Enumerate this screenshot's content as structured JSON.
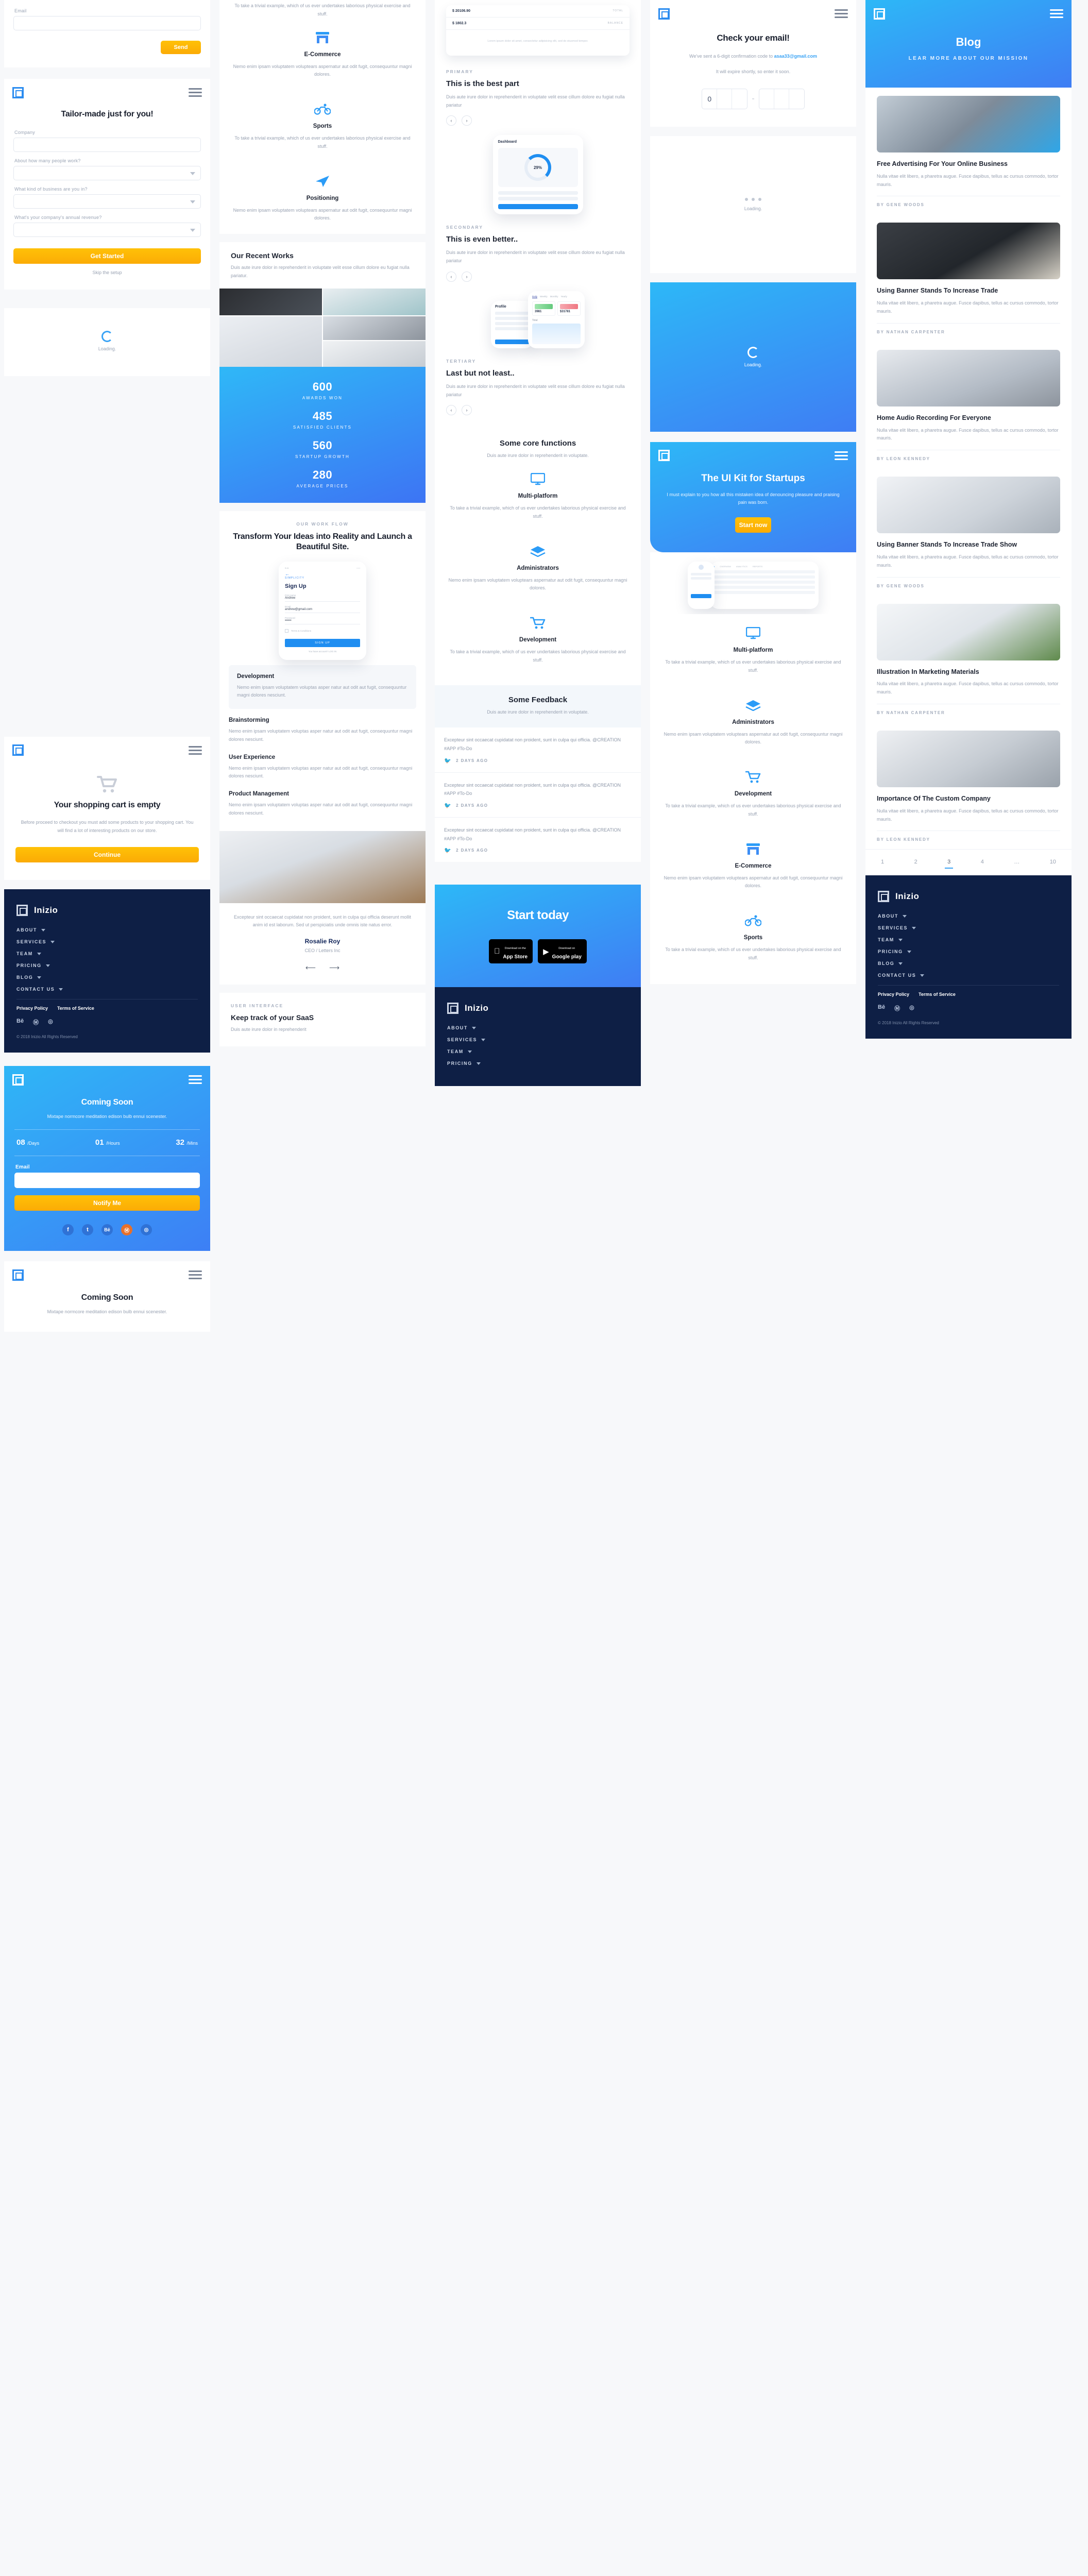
{
  "brand": {
    "name": "Inizio",
    "logo_icon": "inizio-logo-icon"
  },
  "colors": {
    "accent_blue": "#3aa3f5",
    "accent_yellow": "#fbab06",
    "footer_navy": "#0e1f45"
  },
  "footer": {
    "nav": [
      "ABOUT",
      "SERVICES",
      "TEAM",
      "PRICING",
      "BLOG",
      "CONTACT US"
    ],
    "legal": [
      "Privacy Policy",
      "Terms of Service"
    ],
    "social": [
      "Bē",
      "Ⓜ",
      "◎"
    ],
    "copyright": "© 2018 Inizio All Rights Reserved"
  },
  "col1": {
    "contact_form": {
      "email_label": "Email",
      "email_value": "",
      "send_label": "Send"
    },
    "tailor": {
      "title": "Tailor-made just for you!",
      "fields": [
        {
          "label": "Company",
          "type": "text",
          "value": ""
        },
        {
          "label": "About how many people work?",
          "type": "select",
          "value": ""
        },
        {
          "label": "What kind of business are you in?",
          "type": "select",
          "value": ""
        },
        {
          "label": "What's your company's annual revenue?",
          "type": "select",
          "value": ""
        }
      ],
      "submit_label": "Get Started",
      "skip_label": "Skip the setup"
    },
    "loading": {
      "label": "Loading."
    },
    "cart": {
      "title": "Your shopping cart is empty",
      "body": "Before proceed to checkout you must add some products to your shopping cart. You will find a lot of interesting products on our store.",
      "button": "Continue"
    },
    "coming_soon": {
      "title": "Coming Soon",
      "subtitle": "Mixtape normcore meditation edison bulb ennui scenester.",
      "countdown": [
        {
          "value": "08",
          "unit": "/Days"
        },
        {
          "value": "01",
          "unit": "/Hours"
        },
        {
          "value": "32",
          "unit": "/Mins"
        }
      ],
      "email_label": "Email",
      "email_value": "",
      "button": "Notify Me",
      "social": [
        "f",
        "t",
        "Bē",
        "Ⓜ",
        "◎"
      ]
    },
    "coming_soon2": {
      "title": "Coming Soon",
      "subtitle": "Mixtape normcore meditation edison bulb ennui scenester."
    }
  },
  "col2": {
    "features": [
      {
        "icon": "store-icon",
        "title": "E-Commerce",
        "body": "Nemo enim ipsam voluptatem voluptears aspernatur aut odit fugit, consequuntur magni dolores."
      },
      {
        "icon": "bicycle-icon",
        "title": "Sports",
        "body": "To take a trivial example, which of us ever undertakes laborious physical exercise and stuff."
      },
      {
        "icon": "navigation-icon",
        "title": "Positioning",
        "body": "Nemo enim ipsam voluptatem voluptears aspernatur aut odit fugit, consequuntur magni dolores."
      }
    ],
    "top_partial": "To take a trivial example, which of us ever undertakes laborious physical exercise and stuff.",
    "recent": {
      "title": "Our Recent Works",
      "body": "Duis aute irure dolor in reprehenderit in voluptate velit esse cillum dolore eu fugiat nulla pariatur."
    },
    "stats": [
      {
        "value": "600",
        "label": "AWARDS WON"
      },
      {
        "value": "485",
        "label": "SATISFIED CLIENTS"
      },
      {
        "value": "560",
        "label": "STARTUP GROWTH"
      },
      {
        "value": "280",
        "label": "AVERAGE PRICES"
      }
    ],
    "workflow": {
      "eyebrow": "OUR WORK FLOW",
      "title": "Transform Your Ideas into Reality and Launch a Beautiful Site.",
      "phone": {
        "back_label": "SIMPLICITY",
        "heading": "Sign Up",
        "f1": "First name",
        "v1": "Andrew",
        "f2": "Email",
        "v2": "andrew@gmail.com",
        "f3": "Password",
        "v3": "••••••",
        "terms": "Terms & Conditions",
        "cta": "SIGN UP",
        "foot": "You have account? LOG IN"
      },
      "steps": [
        {
          "title": "Development",
          "body": "Nemo enim ipsam voluptatem voluptas asper natur aut odit aut fugit, consequuntur magni dolores nesciunt."
        },
        {
          "title": "Brainstorming",
          "body": "Nemo enim ipsam voluptatem voluptas asper natur aut odit aut fugit, consequuntur magni dolores nesciunt."
        },
        {
          "title": "User Experience",
          "body": "Nemo enim ipsam voluptatem voluptas asper natur aut odit aut fugit, consequuntur magni dolores nesciunt."
        },
        {
          "title": "Product Management",
          "body": "Nemo enim ipsam voluptatem voluptas asper natur aut odit aut fugit, consequuntur magni dolores nesciunt."
        }
      ]
    },
    "testimonial": {
      "quote": "Excepteur sint occaecat cupidatat non proident, sunt in culpa qui officia deserunt mollit anim id est laborum. Sed ut perspiciatis unde omnis iste natus error.",
      "name": "Rosalie Roy",
      "role": "CEO / Letters Inc"
    },
    "ui_section": {
      "eyebrow": "USER INTERFACE",
      "title": "Keep track of your SaaS",
      "body": "Duis aute irure dolor in reprehenderit"
    }
  },
  "col3": {
    "card": {
      "total_value": "$ 20106.90",
      "total_label": "TOTAL",
      "balance_value": "$ 1802.3",
      "balance_label": "BALANCE",
      "note": "Lorem ipsum dolor sit amet, consectetur adipisicing elit, sed do eiusmod tempor."
    },
    "slides": [
      {
        "eyebrow": "PRIMARY",
        "title": "This is the best part",
        "body": "Duis aute irure dolor in reprehenderit in voluptate velit esse cillum dolore eu fugiat nulla pariatur"
      },
      {
        "eyebrow": "SECONDARY",
        "title": "This is even better..",
        "body": "Duis aute irure dolor in reprehenderit in voluptate velit esse cillum dolore eu fugiat nulla pariatur"
      },
      {
        "eyebrow": "TERTIARY",
        "title": "Last but not least..",
        "body": "Duis aute irure dolor in reprehenderit in voluptate velit esse cillum dolore eu fugiat nulla pariatur"
      }
    ],
    "dashboard": {
      "title": "Dashboard",
      "pct": "29%"
    },
    "profile": {
      "title": "Profile",
      "tabs": [
        "Daily",
        "Weekly",
        "Monthly",
        "Yearly"
      ],
      "m1": "3981",
      "m2": "$31781",
      "total_label": "Total"
    },
    "core": {
      "title": "Some core functions",
      "body": "Duis aute irure dolor in reprehenderit in voluptate.",
      "items": [
        {
          "icon": "monitor-icon",
          "title": "Multi-platform",
          "body": "To take a trivial example, which of us ever undertakes laborious physical exercise and stuff."
        },
        {
          "icon": "layers-icon",
          "title": "Administrators",
          "body": "Nemo enim ipsam voluptatem voluptears aspernatur aut odit fugit, consequuntur magni dolores."
        },
        {
          "icon": "cart-icon",
          "title": "Development",
          "body": "To take a trivial example, which of us ever undertakes laborious physical exercise and stuff."
        }
      ]
    },
    "feedback": {
      "title": "Some Feedback",
      "body": "Duis aute irure dolor in reprehenderit in voluptate.",
      "tweets": [
        {
          "text": "Excepteur sint occaecat cupidatat non proident, sunt in culpa qui officia.  @CREATION #APP #To-Do",
          "time": "2 DAYS AGO"
        },
        {
          "text": "Excepteur sint occaecat cupidatat non proident, sunt in culpa qui officia.  @CREATION #APP #To-Do",
          "time": "2 DAYS AGO"
        },
        {
          "text": "Excepteur sint occaecat cupidatat non proident, sunt in culpa qui officia.  @CREATION #APP #To-Do",
          "time": "2 DAYS AGO"
        }
      ]
    },
    "start_today": {
      "title": "Start today",
      "stores": [
        {
          "icon": "apple-icon",
          "small": "Download on the",
          "big": "App Store"
        },
        {
          "icon": "google-play-icon",
          "small": "Download on",
          "big": "Google play"
        }
      ]
    }
  },
  "col4": {
    "verify": {
      "title": "Check your email!",
      "line1_pre": "We've sent a 6-digit confirmation code to ",
      "email": "asaa33@gmail.com",
      "line2": "It will expire shortly, so enter it soon.",
      "code": [
        "0",
        "",
        "",
        "",
        "",
        ""
      ],
      "separator": "-"
    },
    "dots_loading": {
      "label": "Loading."
    },
    "spinner_loading": {
      "label": "Loading."
    },
    "uikit": {
      "title": "The UI Kit for Startups",
      "body": "I must explain to you how all this mistaken idea of denouncing pleasure and praising pain was born.",
      "button": "Start now"
    },
    "core": {
      "items": [
        {
          "icon": "monitor-icon",
          "title": "Multi-platform",
          "body": "To take a trivial example, which of us ever undertakes laborious physical exercise and stuff."
        },
        {
          "icon": "layers-icon",
          "title": "Administrators",
          "body": "Nemo enim ipsam voluptatem voluptears aspernatur aut odit fugit, consequuntur magni dolores."
        },
        {
          "icon": "cart-icon",
          "title": "Development",
          "body": "To take a trivial example, which of us ever undertakes laborious physical exercise and stuff."
        },
        {
          "icon": "store-icon",
          "title": "E-Commerce",
          "body": "Nemo enim ipsam voluptatem voluptears aspernatur aut odit fugit, consequuntur magni dolores."
        },
        {
          "icon": "bicycle-icon",
          "title": "Sports",
          "body": "To take a trivial example, which of us ever undertakes laborious physical exercise and stuff."
        }
      ]
    }
  },
  "col5": {
    "hero": {
      "title": "Blog",
      "subtitle": "LEAR MORE ABOUT OUR MISSION"
    },
    "posts": [
      {
        "title": "Free Advertising For Your Online Business",
        "excerpt": "Nulla vitae elit libero, a pharetra augue. Fusce dapibus, tellus ac cursus commodo, tortor mauris.",
        "author": "BY GENE WOODS",
        "img": "smartwatch-photo"
      },
      {
        "title": "Using Banner Stands To Increase Trade",
        "excerpt": "Nulla vitae elit libero, a pharetra augue. Fusce dapibus, tellus ac cursus commodo, tortor mauris.",
        "author": "BY NATHAN CARPENTER",
        "img": "laptop-couch-photo"
      },
      {
        "title": "Home Audio Recording For Everyone",
        "excerpt": "Nulla vitae elit libero, a pharetra augue. Fusce dapibus, tellus ac cursus commodo, tortor mauris.",
        "author": "BY LEON KENNEDY",
        "img": "desk-phone-photo"
      },
      {
        "title": "Using Banner Stands To Increase Trade Show",
        "excerpt": "Nulla vitae elit libero, a pharetra augue. Fusce dapibus, tellus ac cursus commodo, tortor mauris.",
        "author": "BY GENE WOODS",
        "img": "macbook-photo"
      },
      {
        "title": "Illustration In Marketing Materials",
        "excerpt": "Nulla vitae elit libero, a pharetra augue. Fusce dapibus, tellus ac cursus commodo, tortor mauris.",
        "author": "BY NATHAN CARPENTER",
        "img": "plant-desk-photo"
      },
      {
        "title": "Importance Of The Custom Company",
        "excerpt": "Nulla vitae elit libero, a pharetra augue. Fusce dapibus, tellus ac cursus commodo, tortor mauris.",
        "author": "BY LEON KENNEDY",
        "img": "laptop-white-photo"
      }
    ],
    "pagination": {
      "pages": [
        "1",
        "2",
        "3",
        "4",
        "…",
        "10"
      ],
      "current": "3"
    }
  }
}
